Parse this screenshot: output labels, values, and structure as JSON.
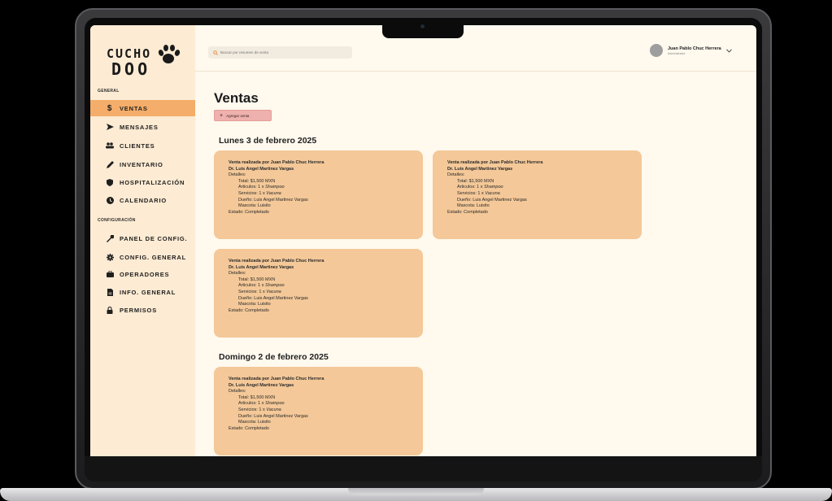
{
  "brand": {
    "line1": "CUCHO",
    "line2": "DOO"
  },
  "sidebar": {
    "general_label": "GENERAL",
    "general_items": [
      {
        "label": "VENTAS",
        "icon": "dollar-icon",
        "active": true
      },
      {
        "label": "MENSAJES",
        "icon": "send-icon",
        "active": false
      },
      {
        "label": "CLIENTES",
        "icon": "users-icon",
        "active": false
      },
      {
        "label": "INVENTARIO",
        "icon": "pencil-icon",
        "active": false
      },
      {
        "label": "HOSPITALIZACIÓN",
        "icon": "shield-icon",
        "active": false
      },
      {
        "label": "CALENDARIO",
        "icon": "clock-icon",
        "active": false
      }
    ],
    "config_label": "CONFIGURACIÓN",
    "config_items": [
      {
        "label": "PANEL DE CONFIG.",
        "icon": "wrench-icon"
      },
      {
        "label": "CONFIG. GENERAL",
        "icon": "gear-icon"
      },
      {
        "label": "OPERADORES",
        "icon": "briefcase-icon"
      },
      {
        "label": "INFO. GENERAL",
        "icon": "document-icon"
      },
      {
        "label": "PERMISOS",
        "icon": "lock-icon"
      }
    ]
  },
  "search": {
    "placeholder": "Buscar por resumen de venta"
  },
  "user": {
    "name": "Juan Pablo Chuc Herrera",
    "role": "Administrador"
  },
  "main": {
    "title": "Ventas",
    "add_button": "Agregar venta",
    "days": [
      {
        "heading": "Lunes 3 de febrero 2025"
      },
      {
        "heading": "Domingo 2 de febrero 2025"
      }
    ],
    "sale": {
      "by": "Venta realizada por Juan Pablo Chuc Herrera",
      "doctor": "Dr. Luis Angel Martinez Vargas",
      "details": "Detalles:",
      "total": "Total: $1,500 MXN",
      "articles_prefix": "Articulos: 1 x ",
      "articles_item": "Shampoo",
      "services_prefix": "Servicios: 1 x ",
      "services_item": "Vacuna",
      "owner": "Dueño: Luis Angel Martinez Vargas",
      "pet": "Mascota: Luisito",
      "status": "Estado: Completado"
    }
  },
  "colors": {
    "sidebar": "#fdebd3",
    "active": "#f4ad6a",
    "card": "#f4c898",
    "button": "#efb1ad",
    "page": "#fff9ee"
  }
}
